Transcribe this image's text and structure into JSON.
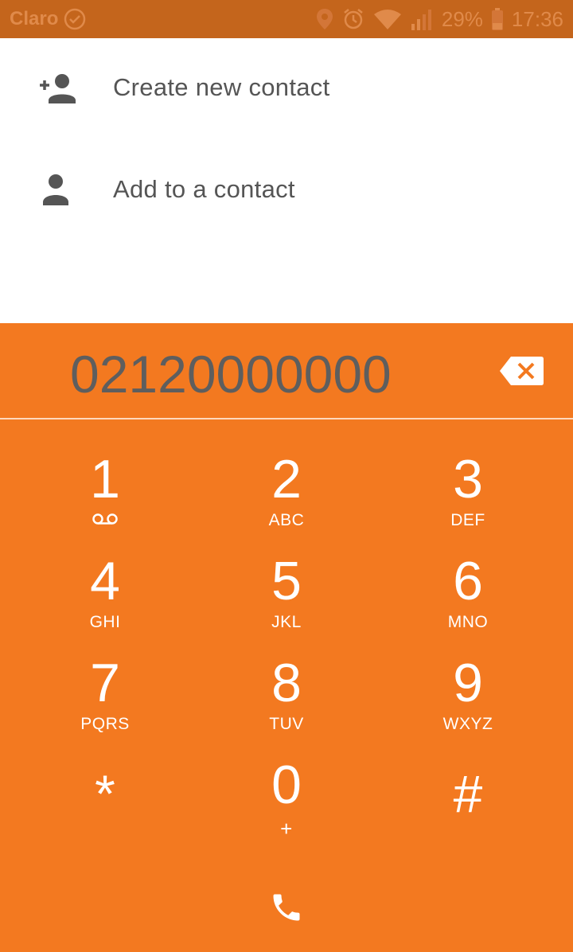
{
  "status_bar": {
    "carrier": "Claro",
    "battery": "29%",
    "time": "17:36",
    "icons": [
      "check-circle-icon",
      "location-icon",
      "alarm-icon",
      "wifi-icon",
      "signal-icon",
      "battery-icon"
    ]
  },
  "actions": [
    {
      "label": "Create new contact",
      "icon": "add-person-icon"
    },
    {
      "label": "Add to a contact",
      "icon": "person-icon"
    }
  ],
  "dialpad": {
    "number": "02120000000",
    "accent_color": "#f37920",
    "keys": [
      {
        "digit": "1",
        "letters": "",
        "sub_icon": "voicemail-icon"
      },
      {
        "digit": "2",
        "letters": "ABC"
      },
      {
        "digit": "3",
        "letters": "DEF"
      },
      {
        "digit": "4",
        "letters": "GHI"
      },
      {
        "digit": "5",
        "letters": "JKL"
      },
      {
        "digit": "6",
        "letters": "MNO"
      },
      {
        "digit": "7",
        "letters": "PQRS"
      },
      {
        "digit": "8",
        "letters": "TUV"
      },
      {
        "digit": "9",
        "letters": "WXYZ"
      },
      {
        "digit": "*",
        "letters": ""
      },
      {
        "digit": "0",
        "letters": "+"
      },
      {
        "digit": "#",
        "letters": ""
      }
    ],
    "backspace_icon": "backspace-icon",
    "call_icon": "phone-icon"
  }
}
